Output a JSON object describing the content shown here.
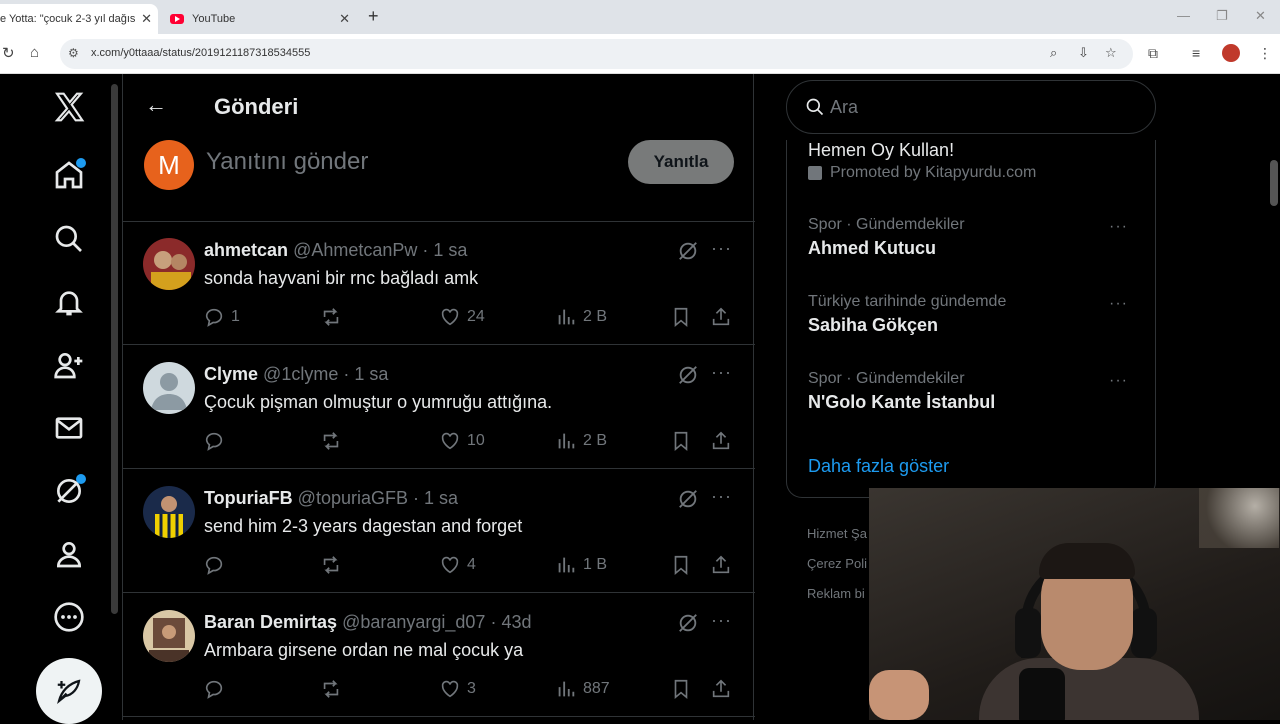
{
  "browser": {
    "active_tab_title": "e Yotta: \"çocuk 2-3 yıl dağıst",
    "second_tab_title": "YouTube",
    "url": "x.com/y0ttaaa/status/2019121187318534555"
  },
  "header": {
    "title": "Gönderi"
  },
  "composer": {
    "avatar_letter": "M",
    "placeholder": "Yanıtını gönder",
    "reply_button": "Yanıtla"
  },
  "tweets": [
    {
      "name": "ahmetcan",
      "handle": "@AhmetcanPw",
      "time": "· 1 sa",
      "text": "sonda hayvani bir rnc bağladı amk",
      "replies": "1",
      "likes": "24",
      "views": "2 B",
      "avatar_color": "#8b2a2a"
    },
    {
      "name": "Clyme",
      "handle": "@1clyme",
      "time": "· 1 sa",
      "text": "Çocuk pişman olmuştur o yumruğu attığına.",
      "replies": "",
      "likes": "10",
      "views": "2 B",
      "avatar_color": "#cfd9de"
    },
    {
      "name": "TopuriaFB",
      "handle": "@topuriaGFB",
      "time": "· 1 sa",
      "text": "send  him 2-3 years dagestan and forget",
      "replies": "",
      "likes": "4",
      "views": "1 B",
      "avatar_color": "#1a2a4a"
    },
    {
      "name": "Baran Demirtaş",
      "handle": "@baranyargi_d07",
      "time": "· 43d",
      "text": "Armbara girsene ordan ne mal çocuk ya",
      "replies": "",
      "likes": "3",
      "views": "887",
      "avatar_color": "#6b4a3a"
    }
  ],
  "sidebar": {
    "search_placeholder": "Ara",
    "promo_title": "Hemen Oy Kullan!",
    "promo_by": "Promoted by Kitapyurdu.com",
    "trends": [
      {
        "meta": "Spor · Gündemdekiler",
        "name": "Ahmed Kutucu"
      },
      {
        "meta": "Türkiye tarihinde gündemde",
        "name": "Sabiha Gökçen"
      },
      {
        "meta": "Spor · Gündemdekiler",
        "name": "N'Golo Kante İstanbul"
      }
    ],
    "show_more": "Daha fazla göster",
    "footer": [
      "Hizmet Şa",
      "Çerez Poli",
      "Reklam bi"
    ]
  },
  "colors": {
    "accent": "#1d9bf0",
    "background": "#000000",
    "muted": "#71767b"
  }
}
